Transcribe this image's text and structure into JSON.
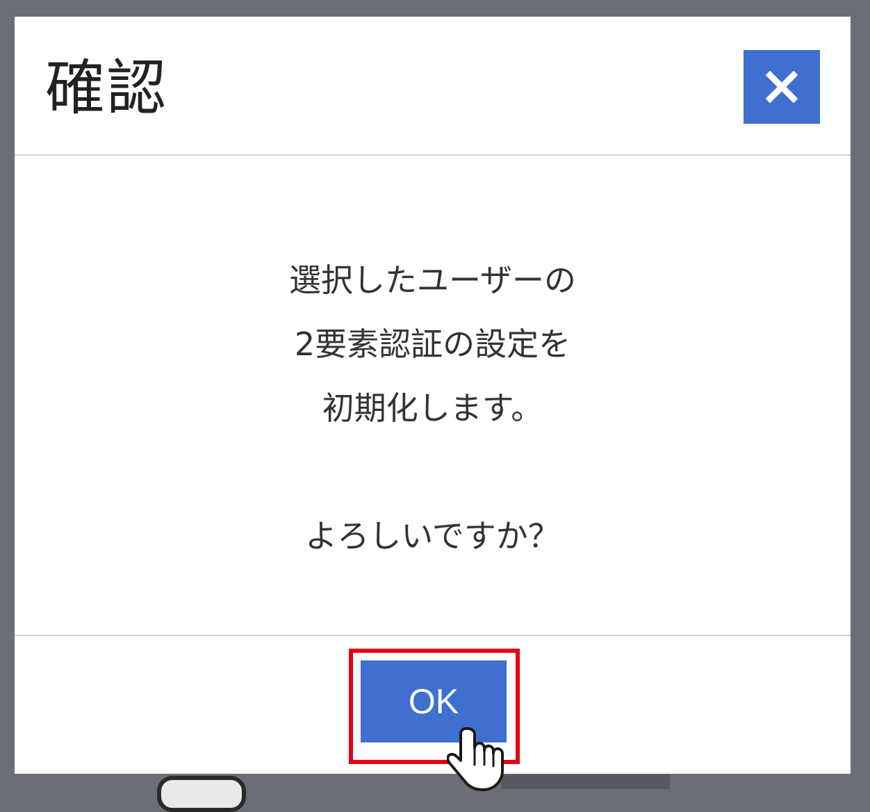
{
  "dialog": {
    "title": "確認",
    "close_icon": "close-icon",
    "message_lines": [
      "選択したユーザーの",
      "2要素認証の設定を",
      "初期化します。",
      "",
      "よろしいですか？"
    ],
    "ok_label": "OK"
  },
  "colors": {
    "accent": "#3f6fcf",
    "highlight": "#e60012",
    "backdrop": "#6b6e76"
  },
  "pointer_icon": "hand-pointer-icon"
}
